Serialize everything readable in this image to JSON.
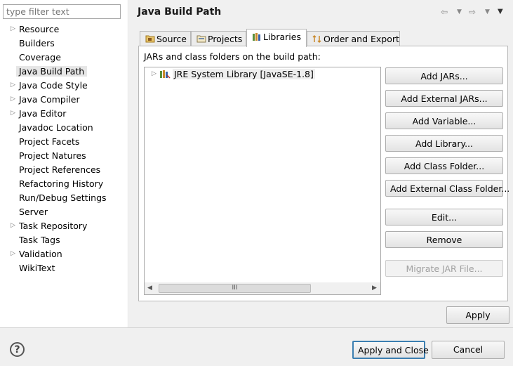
{
  "sidebar": {
    "filter_placeholder": "type filter text",
    "items": [
      {
        "label": "Resource",
        "expandable": true
      },
      {
        "label": "Builders",
        "expandable": false
      },
      {
        "label": "Coverage",
        "expandable": false
      },
      {
        "label": "Java Build Path",
        "expandable": false,
        "selected": true
      },
      {
        "label": "Java Code Style",
        "expandable": true
      },
      {
        "label": "Java Compiler",
        "expandable": true
      },
      {
        "label": "Java Editor",
        "expandable": true
      },
      {
        "label": "Javadoc Location",
        "expandable": false
      },
      {
        "label": "Project Facets",
        "expandable": false
      },
      {
        "label": "Project Natures",
        "expandable": false
      },
      {
        "label": "Project References",
        "expandable": false
      },
      {
        "label": "Refactoring History",
        "expandable": false
      },
      {
        "label": "Run/Debug Settings",
        "expandable": false
      },
      {
        "label": "Server",
        "expandable": false
      },
      {
        "label": "Task Repository",
        "expandable": true
      },
      {
        "label": "Task Tags",
        "expandable": false
      },
      {
        "label": "Validation",
        "expandable": true
      },
      {
        "label": "WikiText",
        "expandable": false
      }
    ]
  },
  "page": {
    "title": "Java Build Path",
    "tabs": [
      {
        "label": "Source",
        "icon": "source-folder-icon"
      },
      {
        "label": "Projects",
        "icon": "projects-folder-icon"
      },
      {
        "label": "Libraries",
        "icon": "libraries-icon",
        "active": true
      },
      {
        "label": "Order and Export",
        "icon": "order-export-icon"
      }
    ],
    "caption": "JARs and class folders on the build path:",
    "libraries": [
      {
        "label": "JRE System Library [JavaSE-1.8]",
        "icon": "jre-library-icon"
      }
    ],
    "scrollbar_grip": "III",
    "buttons": {
      "add_jars": "Add JARs...",
      "add_external_jars": "Add External JARs...",
      "add_variable": "Add Variable...",
      "add_library": "Add Library...",
      "add_class_folder": "Add Class Folder...",
      "add_external_class_folder": "Add External Class Folder...",
      "edit": "Edit...",
      "remove": "Remove",
      "migrate_jar": "Migrate JAR File..."
    },
    "apply": "Apply"
  },
  "footer": {
    "help": "?",
    "apply_and_close": "Apply and Close",
    "cancel": "Cancel"
  }
}
